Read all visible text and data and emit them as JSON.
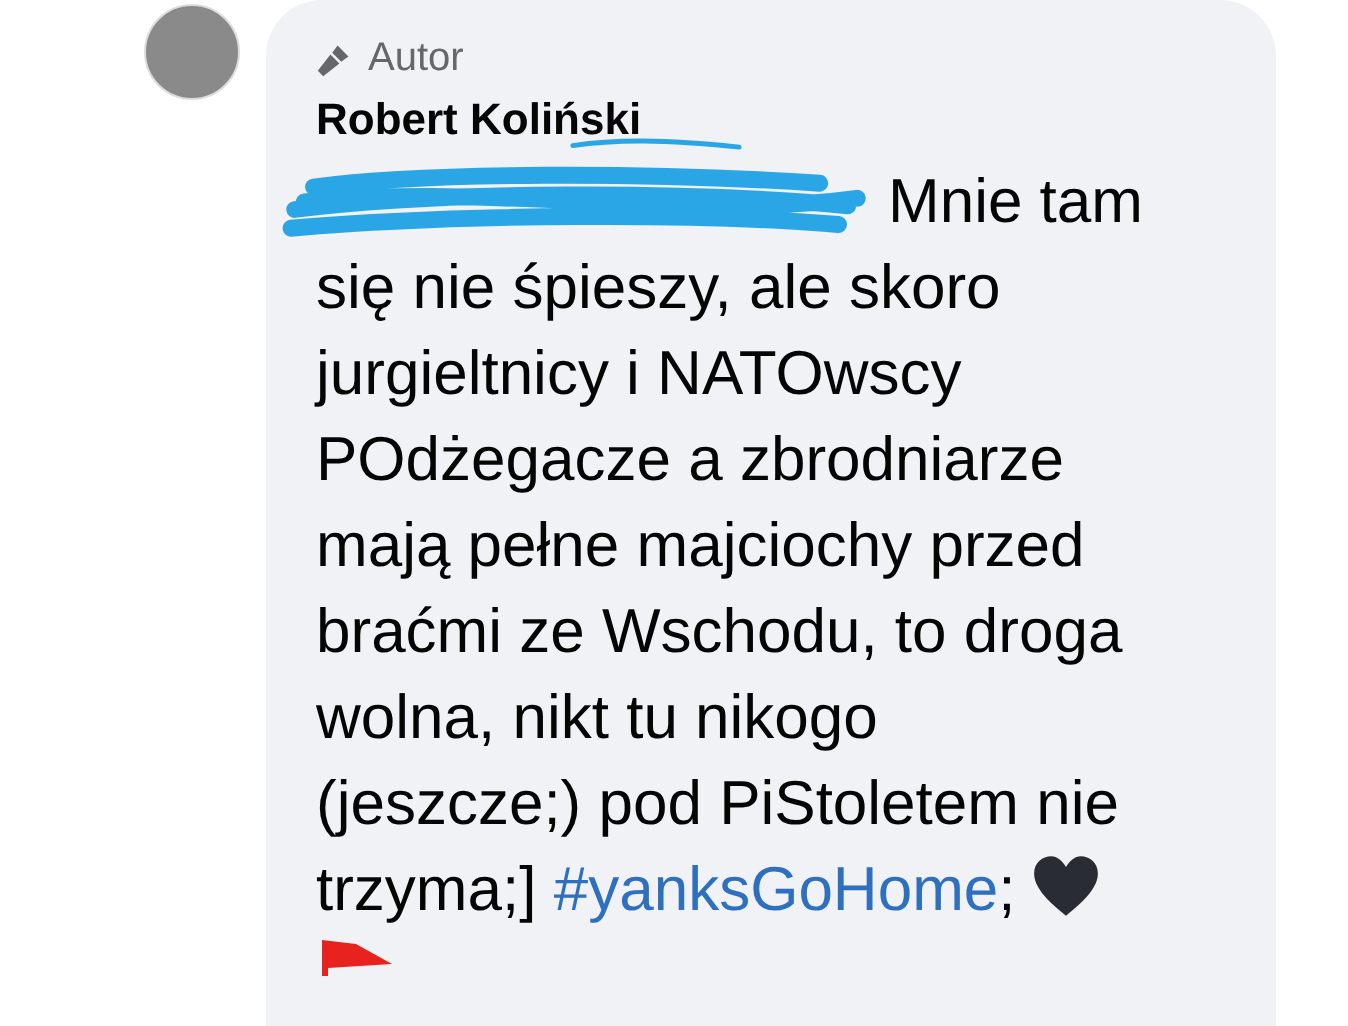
{
  "comment": {
    "badge": "Autor",
    "author": "Robert Koliński",
    "lead": "Mnie tam",
    "text": "się nie śpieszy, ale skoro jurgieltnicy i NATOwscy POdżegacze a zbrodniarze mają pełne majciochy przed braćmi ze Wschodu, to droga wolna, nikt tu nikogo (jeszcze;) pod PiStoletem nie trzyma;]",
    "hashtag": "#yanksGoHome",
    "after": ";"
  }
}
